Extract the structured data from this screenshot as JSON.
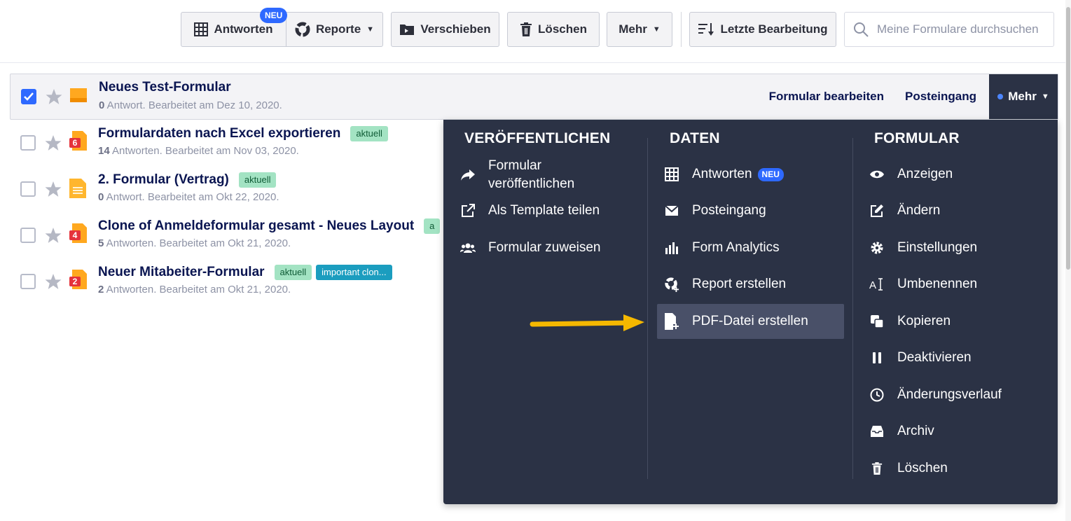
{
  "toolbar": {
    "antworten_label": "Antworten",
    "neu_badge": "NEU",
    "reporte_label": "Reporte",
    "verschieben_label": "Verschieben",
    "loeschen_label": "Löschen",
    "mehr_label": "Mehr",
    "sort_label": "Letzte Bearbeitung",
    "search_placeholder": "Meine Formulare durchsuchen"
  },
  "forms": [
    {
      "title": "Neues Test-Formular",
      "count": "0",
      "subtitle": " Antwort. Bearbeitet am Dez 10, 2020.",
      "checked": true,
      "badge": "",
      "tags": []
    },
    {
      "title": "Formulardaten nach Excel exportieren",
      "count": "14",
      "subtitle": " Antworten. Bearbeitet am Nov 03, 2020.",
      "checked": false,
      "badge": "6",
      "tags": [
        "aktuell"
      ]
    },
    {
      "title": "2. Formular (Vertrag)",
      "count": "0",
      "subtitle": " Antwort. Bearbeitet am Okt 22, 2020.",
      "checked": false,
      "badge": "",
      "tags": [
        "aktuell"
      ]
    },
    {
      "title": "Clone of Anmeldeformular gesamt - Neues Layout",
      "count": "5",
      "subtitle": " Antworten. Bearbeitet am Okt 21, 2020.",
      "checked": false,
      "badge": "4",
      "tags": [
        "a"
      ]
    },
    {
      "title": "Neuer Mitabeiter-Formular",
      "count": "2",
      "subtitle": " Antworten. Bearbeitet am Okt 21, 2020.",
      "checked": false,
      "badge": "2",
      "tags": [
        "aktuell",
        "important clon..."
      ]
    }
  ],
  "row_actions": {
    "edit": "Formular bearbeiten",
    "inbox": "Posteingang",
    "more": "Mehr"
  },
  "menu": {
    "publish": {
      "heading": "VERÖFFENTLICHEN",
      "items": [
        "Formular\nveröffentlichen",
        "Als Template teilen",
        "Formular zuweisen"
      ]
    },
    "data": {
      "heading": "DATEN",
      "items": [
        "Antworten",
        "Posteingang",
        "Form Analytics",
        "Report erstellen",
        "PDF-Datei erstellen"
      ],
      "neu_badge": "NEU"
    },
    "form": {
      "heading": "FORMULAR",
      "items": [
        "Anzeigen",
        "Ändern",
        "Einstellungen",
        "Umbenennen",
        "Kopieren",
        "Deaktivieren",
        "Änderungsverlauf",
        "Archiv",
        "Löschen"
      ]
    }
  },
  "colors": {
    "menu_bg": "#2b3245",
    "highlight_bg": "#495068",
    "accent_blue": "#2e69ff",
    "tag_green": "#a3e3c3",
    "tag_teal": "#1b9dbf",
    "arrow": "#f5b800"
  }
}
